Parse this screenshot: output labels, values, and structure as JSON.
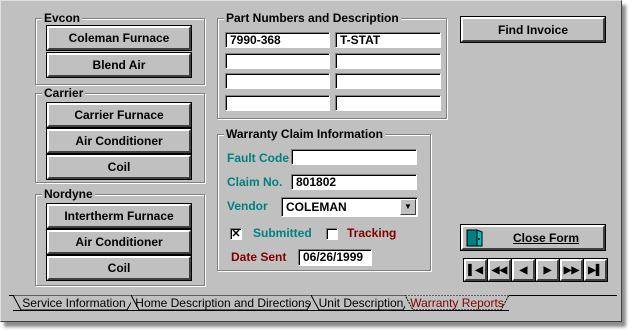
{
  "groups": {
    "evcon": "Evcon",
    "carrier": "Carrier",
    "nordyne": "Nordyne",
    "parts": "Part Numbers and Description",
    "warranty": "Warranty Claim Information"
  },
  "buttons": {
    "coleman_furnace": "Coleman Furnace",
    "blend_air": "Blend Air",
    "carrier_furnace": "Carrier Furnace",
    "carrier_ac": "Air Conditioner",
    "carrier_coil": "Coil",
    "intertherm_furnace": "Intertherm Furnace",
    "nordyne_ac": "Air Conditioner",
    "nordyne_coil": "Coil",
    "find_invoice": "Find Invoice",
    "close_form": "Close Form"
  },
  "parts": {
    "rows": [
      {
        "part_number": "7990-368",
        "description": "T-STAT"
      },
      {
        "part_number": "",
        "description": ""
      },
      {
        "part_number": "",
        "description": ""
      },
      {
        "part_number": "",
        "description": ""
      }
    ]
  },
  "warranty": {
    "fault_code_label": "Fault Code",
    "fault_code_value": "",
    "claim_no_label": "Claim No.",
    "claim_no_value": "801802",
    "vendor_label": "Vendor",
    "vendor_value": "COLEMAN",
    "submitted_label": "Submitted",
    "submitted_checked": true,
    "submitted_mark": "✕",
    "tracking_label": "Tracking",
    "tracking_checked": false,
    "date_sent_label": "Date Sent",
    "date_sent_value": "06/26/1999"
  },
  "tabs": [
    {
      "label": "Service Information",
      "active": false
    },
    {
      "label": "Home Description and Directions",
      "active": false
    },
    {
      "label": "Unit Description",
      "active": false
    },
    {
      "label": "Warranty Reports",
      "active": true
    }
  ],
  "colors": {
    "teal": "#008080",
    "maroon": "#800000",
    "face": "#c0c0c0",
    "active_tab": "#800000"
  },
  "icons": {
    "close_form": "door-exit-icon",
    "nav_first": "first-record-icon",
    "nav_prev_page": "previous-page-icon",
    "nav_prev": "previous-record-icon",
    "nav_next": "next-record-icon",
    "nav_next_page": "next-page-icon",
    "nav_last": "last-record-icon"
  }
}
